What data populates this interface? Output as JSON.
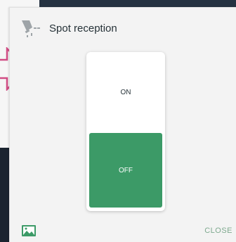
{
  "dialog": {
    "title": "Spot reception",
    "title_icon": "spotlight-icon",
    "close_label": "CLOSE",
    "image_icon": "image-icon"
  },
  "switch": {
    "on_label": "ON",
    "off_label": "OFF",
    "state": "OFF",
    "active_color": "#3c9a67"
  },
  "colors": {
    "accent": "#3c9a67",
    "close_text": "#7ea98e",
    "arrow": "#d14c84"
  }
}
